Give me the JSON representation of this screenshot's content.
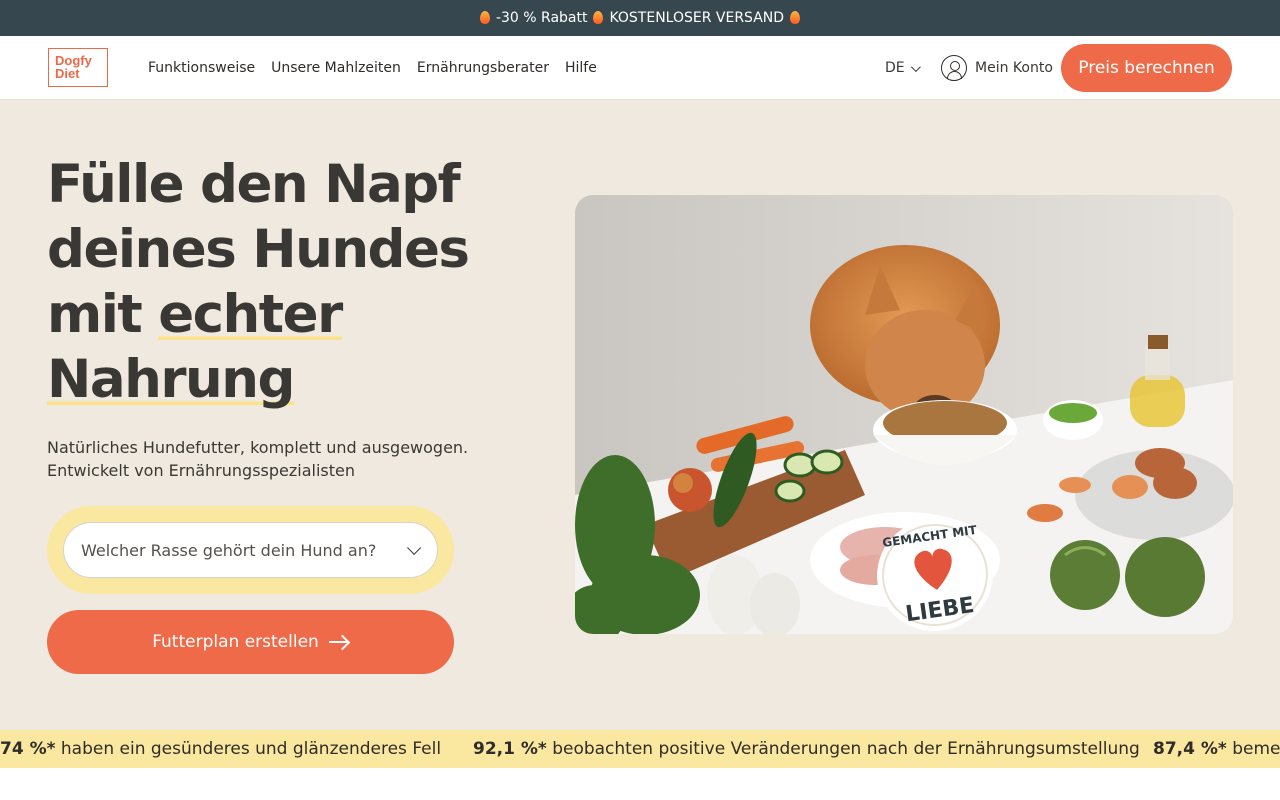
{
  "promo": {
    "text": "-30 % Rabatt",
    "text2": "KOSTENLOSER VERSAND"
  },
  "header": {
    "logo_line1": "Dogfy",
    "logo_line2": "Diet",
    "nav": [
      "Funktionsweise",
      "Unsere Mahlzeiten",
      "Ernährungsberater",
      "Hilfe"
    ],
    "language": "DE",
    "account_label": "Mein Konto",
    "cta_label": "Preis berechnen"
  },
  "hero": {
    "headline_lines": [
      "Fülle den Napf",
      "deines Hundes",
      "mit ",
      "echter",
      "Nahrung"
    ],
    "subtitle_lines": [
      "Natürliches Hundefutter, komplett und ausgewogen.",
      "Entwickelt von Ernährungsspezialisten"
    ],
    "breed_placeholder": "Welcher Rasse gehört dein Hund an?",
    "plan_button": "Futterplan erstellen",
    "badge_line1": "GEMACHT MIT",
    "badge_line2": "LIEBE"
  },
  "ticker": [
    {
      "value": "74 %*",
      "text": " haben ein gesünderes und glänzenderes Fell"
    },
    {
      "value": "92,1 %*",
      "text": " beobachten positive Veränderungen nach der Ernährungsumstellung"
    },
    {
      "value": "87,4 %*",
      "text": " bemerke"
    }
  ],
  "colors": {
    "accent": "#ef6a48",
    "promo_bg": "#37474f",
    "highlight": "#fbe8a0",
    "page_bg": "#efe9e0"
  }
}
